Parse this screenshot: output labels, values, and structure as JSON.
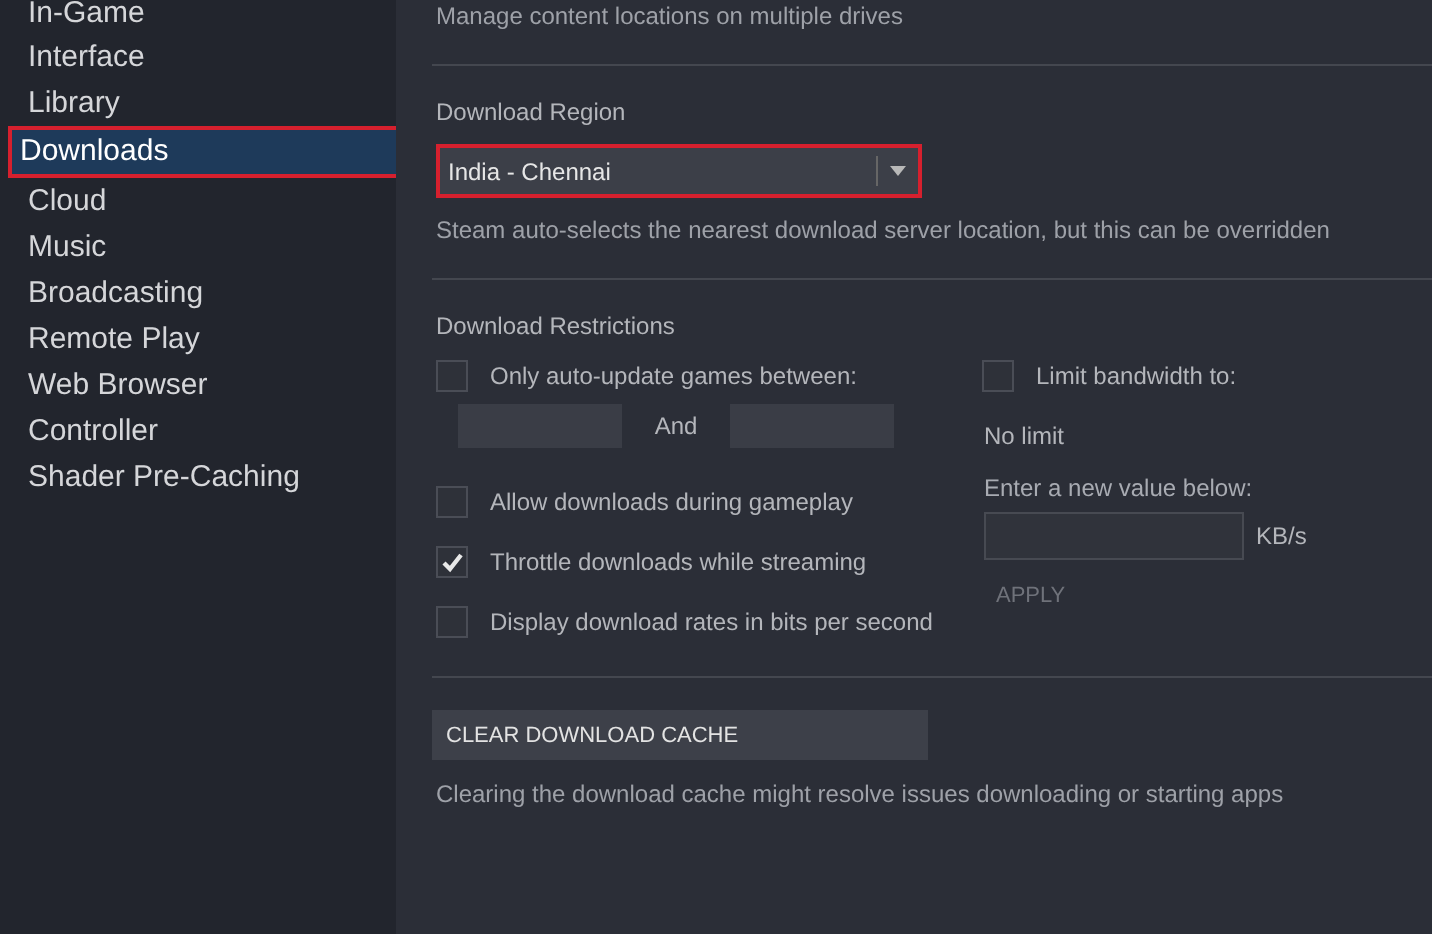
{
  "sidebar": {
    "items": [
      {
        "label": "In-Game",
        "selected": false
      },
      {
        "label": "Interface",
        "selected": false
      },
      {
        "label": "Library",
        "selected": false
      },
      {
        "label": "Downloads",
        "selected": true
      },
      {
        "label": "Cloud",
        "selected": false
      },
      {
        "label": "Music",
        "selected": false
      },
      {
        "label": "Broadcasting",
        "selected": false
      },
      {
        "label": "Remote Play",
        "selected": false
      },
      {
        "label": "Web Browser",
        "selected": false
      },
      {
        "label": "Controller",
        "selected": false
      },
      {
        "label": "Shader Pre-Caching",
        "selected": false
      }
    ]
  },
  "content_locations": {
    "text": "Manage content locations on multiple drives"
  },
  "download_region": {
    "heading": "Download Region",
    "value": "India - Chennai",
    "highlighted": true,
    "hint": "Steam auto-selects the nearest download server location, but this can be overridden"
  },
  "restrictions": {
    "heading": "Download Restrictions",
    "auto_update": {
      "label": "Only auto-update games between:",
      "checked": false,
      "joiner": "And"
    },
    "options": [
      {
        "label": "Allow downloads during gameplay",
        "checked": false
      },
      {
        "label": "Throttle downloads while streaming",
        "checked": true
      },
      {
        "label": "Display download rates in bits per second",
        "checked": false
      }
    ],
    "bandwidth": {
      "label": "Limit bandwidth to:",
      "checked": false,
      "current": "No limit",
      "prompt": "Enter a new value below:",
      "unit": "KB/s",
      "apply": "APPLY"
    }
  },
  "cache": {
    "button": "CLEAR DOWNLOAD CACHE",
    "hint": "Clearing the download cache might resolve issues downloading or starting apps"
  }
}
